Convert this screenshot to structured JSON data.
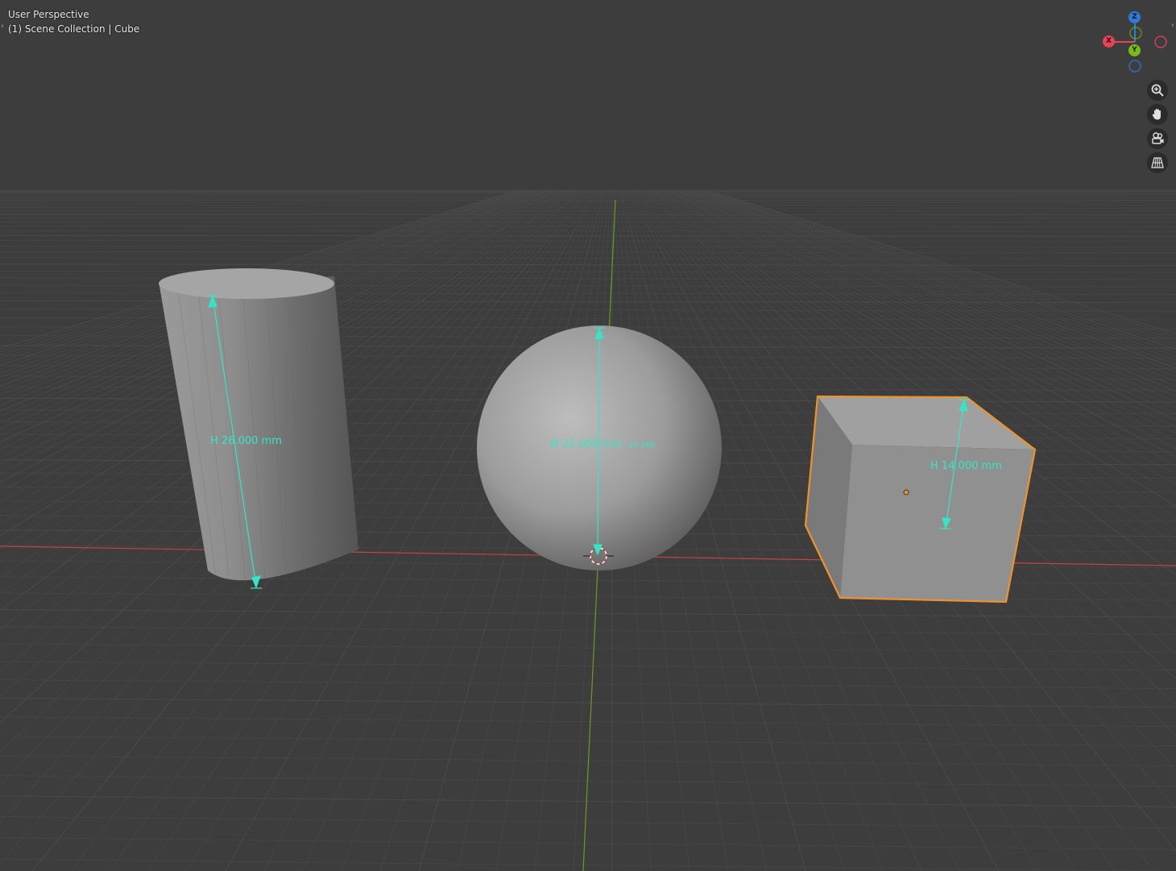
{
  "viewport": {
    "view_name": "User Perspective",
    "scene_info": "(1) Scene Collection | Cube"
  },
  "gizmo": {
    "axes": [
      {
        "name": "Z",
        "color": "#2e7ad6"
      },
      {
        "name": "Y",
        "color": "#79ba1c"
      },
      {
        "name": "X",
        "color": "#e8435a"
      }
    ]
  },
  "nav_buttons": [
    {
      "icon": "zoom-icon"
    },
    {
      "icon": "hand-pan-icon"
    },
    {
      "icon": "camera-icon"
    },
    {
      "icon": "perspective-grid-icon"
    }
  ],
  "objects": {
    "cylinder": {
      "dimension_label": "H 26.000 mm"
    },
    "sphere": {
      "dimension_label": "Ø 22.000 mm",
      "tolerance_label": "±0.000"
    },
    "cube": {
      "dimension_label": "H 14.000 mm",
      "selected": true
    }
  },
  "colors": {
    "background": "#3d3d3d",
    "grid": "#4a4a4a",
    "x_axis": "#c84040",
    "y_axis": "#6a9a28",
    "dimension": "#35e6c6",
    "selection": "#f0922a"
  }
}
